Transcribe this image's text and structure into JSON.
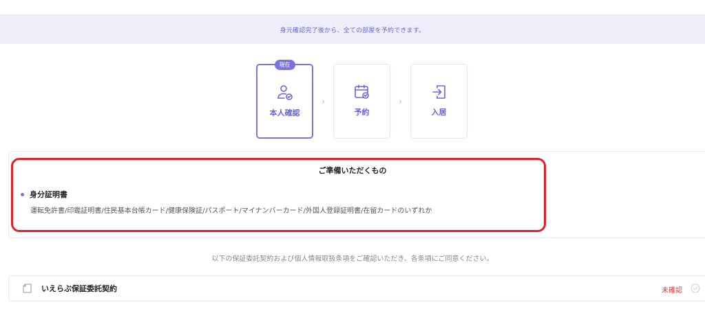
{
  "banner": {
    "text": "身元確認完了後から、全ての部屋を予約できます。"
  },
  "steps": {
    "items": [
      {
        "label": "本人確認",
        "badge": "現在",
        "icon": "person-check-icon"
      },
      {
        "label": "予約",
        "icon": "calendar-check-icon"
      },
      {
        "label": "入居",
        "icon": "enter-icon"
      }
    ],
    "separator": "›"
  },
  "prep": {
    "title": "ご準備いただくもの",
    "id_heading": "身分証明書",
    "id_desc": "運転免許書/印鑑証明書/住民基本台帳カード/健康保険証/パスポート/マイナンバーカード/外国人登録証明書/在留カードのいずれか"
  },
  "consent": {
    "text": "以下の保証委託契約および個人情報取扱条項をご確認いただき、各条項にご同意ください。"
  },
  "contract": {
    "title": "いえらぶ保証委託契約",
    "status": "未確認"
  },
  "colors": {
    "accent": "#7b72e0",
    "banner_bg": "#eeeefb",
    "highlight": "#e41e25",
    "status": "#e23a3a"
  }
}
